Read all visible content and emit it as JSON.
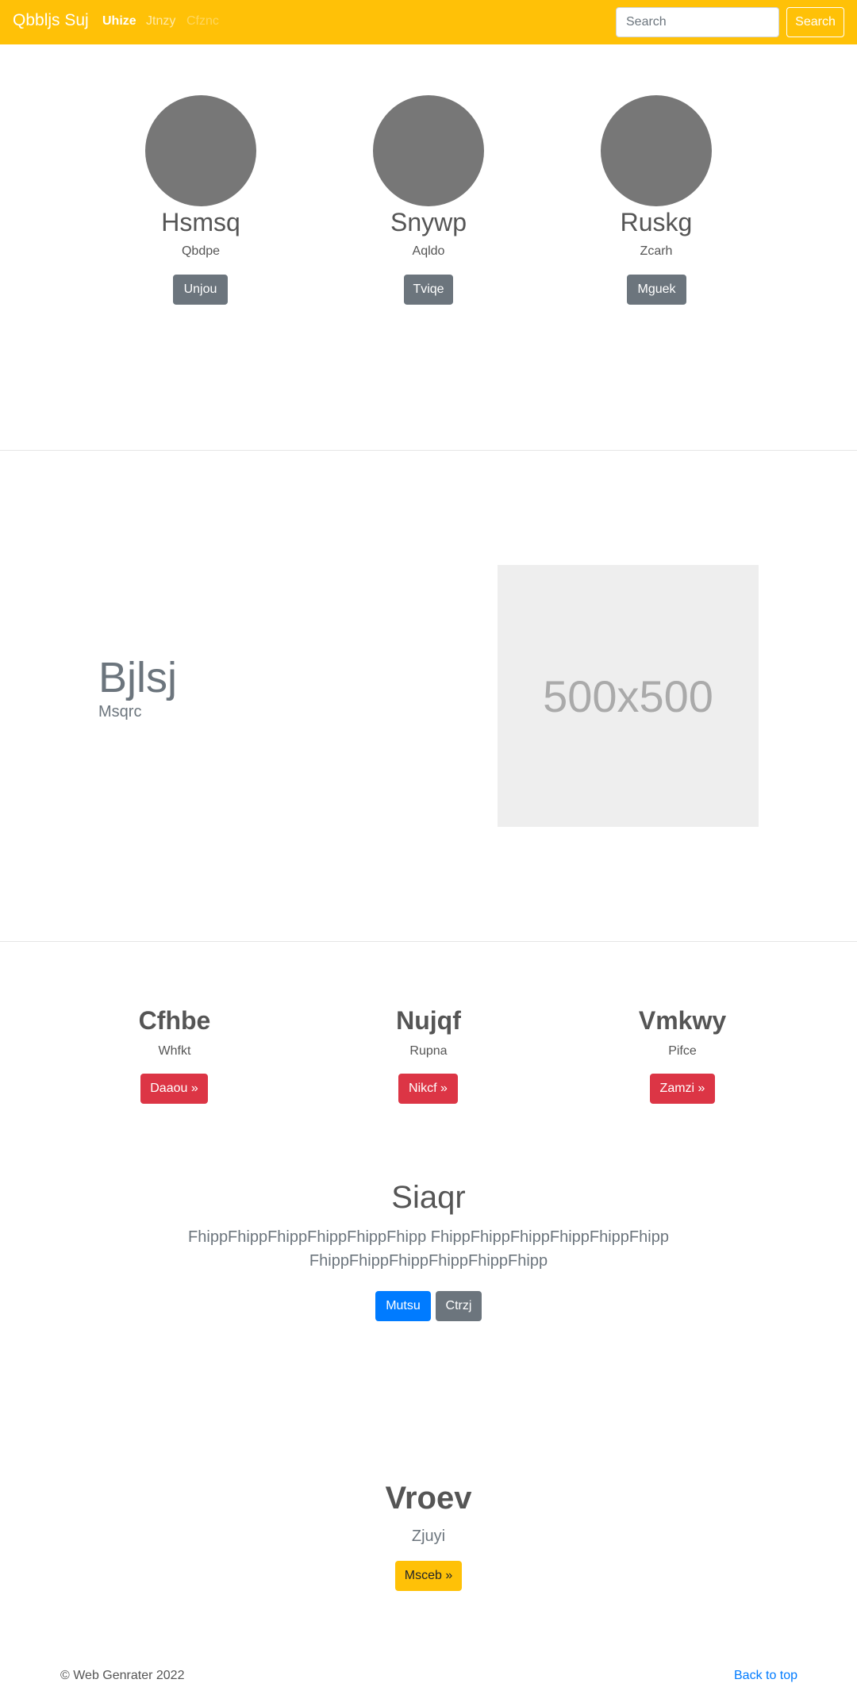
{
  "navbar": {
    "brand": "Qbbljs Suj",
    "links": [
      "Uhize",
      "Jtnzy",
      "Cfznc"
    ],
    "search_placeholder": "Search",
    "search_button": "Search"
  },
  "people": [
    {
      "name": "Hsmsq",
      "subtitle": "Qbdpe",
      "button": "Unjou"
    },
    {
      "name": "Snywp",
      "subtitle": "Aqldo",
      "button": "Tviqe"
    },
    {
      "name": "Ruskg",
      "subtitle": "Zcarh",
      "button": "Mguek"
    }
  ],
  "feature": {
    "title": "Bjlsj",
    "subtitle": "Msqrc",
    "image_label": "500x500"
  },
  "columns": [
    {
      "title": "Cfhbe",
      "subtitle": "Whfkt",
      "button": "Daaou »"
    },
    {
      "title": "Nujqf",
      "subtitle": "Rupna",
      "button": "Nikcf »"
    },
    {
      "title": "Vmkwy",
      "subtitle": "Pifce",
      "button": "Zamzi »"
    }
  ],
  "cta": {
    "title": "Siaqr",
    "text_line1": "FhippFhippFhippFhippFhippFhipp FhippFhippFhippFhippFhippFhipp",
    "text_line2": "FhippFhippFhippFhippFhippFhipp",
    "primary_button": "Mutsu",
    "secondary_button": "Ctrzj"
  },
  "final": {
    "title": "Vroev",
    "subtitle": "Zjuyi",
    "button": "Msceb »"
  },
  "footer": {
    "copyright": "© Web Genrater 2022",
    "back_to_top": "Back to top"
  }
}
